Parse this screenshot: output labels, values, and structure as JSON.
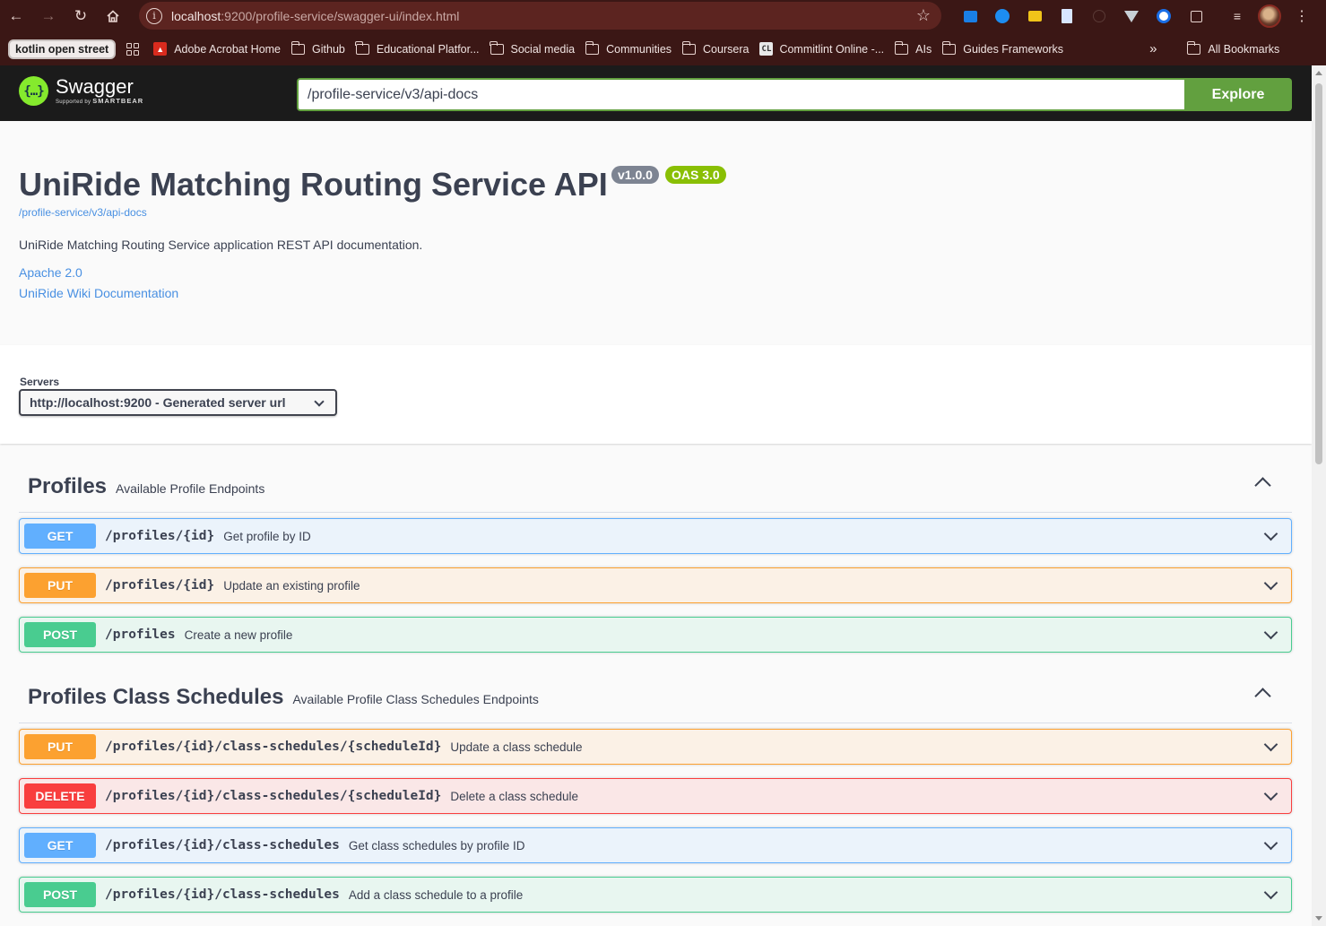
{
  "browser": {
    "url_host": "localhost",
    "url_rest": ":9200/profile-service/swagger-ui/index.html",
    "bookmarks": [
      {
        "label": "kotlin open street",
        "type": "chip"
      },
      {
        "label": "Adobe Acrobat Home",
        "type": "pdf"
      },
      {
        "label": "Github",
        "type": "folder"
      },
      {
        "label": "Educational Platfor...",
        "type": "folder"
      },
      {
        "label": "Social media",
        "type": "folder"
      },
      {
        "label": "Communities",
        "type": "folder"
      },
      {
        "label": "Coursera",
        "type": "folder"
      },
      {
        "label": "Commitlint Online -...",
        "type": "cl"
      },
      {
        "label": "AIs",
        "type": "folder"
      },
      {
        "label": "Guides Frameworks",
        "type": "folder"
      }
    ],
    "more_label": "»",
    "all_bookmarks": "All Bookmarks",
    "cl_icon_text": "CL"
  },
  "swagger": {
    "logo_name": "Swagger",
    "logo_sub_prefix": "Supported by",
    "logo_sub_brand": "SMARTBEAR",
    "logo_glyph": "{…}",
    "explore_value": "/profile-service/v3/api-docs",
    "explore_label": "Explore"
  },
  "info": {
    "title": "UniRide Matching Routing Service API",
    "version": "v1.0.0",
    "oas": "OAS 3.0",
    "spec_url": "/profile-service/v3/api-docs",
    "description": "UniRide Matching Routing Service application REST API documentation.",
    "license": "Apache 2.0",
    "docs_link": "UniRide Wiki Documentation"
  },
  "servers": {
    "label": "Servers",
    "selected": "http://localhost:9200 - Generated server url"
  },
  "tags": [
    {
      "name": "Profiles",
      "description": "Available Profile Endpoints",
      "operations": [
        {
          "method": "GET",
          "path": "/profiles/{id}",
          "summary": "Get profile by ID"
        },
        {
          "method": "PUT",
          "path": "/profiles/{id}",
          "summary": "Update an existing profile"
        },
        {
          "method": "POST",
          "path": "/profiles",
          "summary": "Create a new profile"
        }
      ]
    },
    {
      "name": "Profiles Class Schedules",
      "description": "Available Profile Class Schedules Endpoints",
      "operations": [
        {
          "method": "PUT",
          "path": "/profiles/{id}/class-schedules/{scheduleId}",
          "summary": "Update a class schedule"
        },
        {
          "method": "DELETE",
          "path": "/profiles/{id}/class-schedules/{scheduleId}",
          "summary": "Delete a class schedule"
        },
        {
          "method": "GET",
          "path": "/profiles/{id}/class-schedules",
          "summary": "Get class schedules by profile ID"
        },
        {
          "method": "POST",
          "path": "/profiles/{id}/class-schedules",
          "summary": "Add a class schedule to a profile"
        }
      ]
    }
  ],
  "colors": {
    "get": "#61affe",
    "put": "#fca130",
    "post": "#49cc90",
    "delete": "#f93e3e",
    "explore": "#62a03f",
    "swagger_green": "#85ea2d"
  }
}
